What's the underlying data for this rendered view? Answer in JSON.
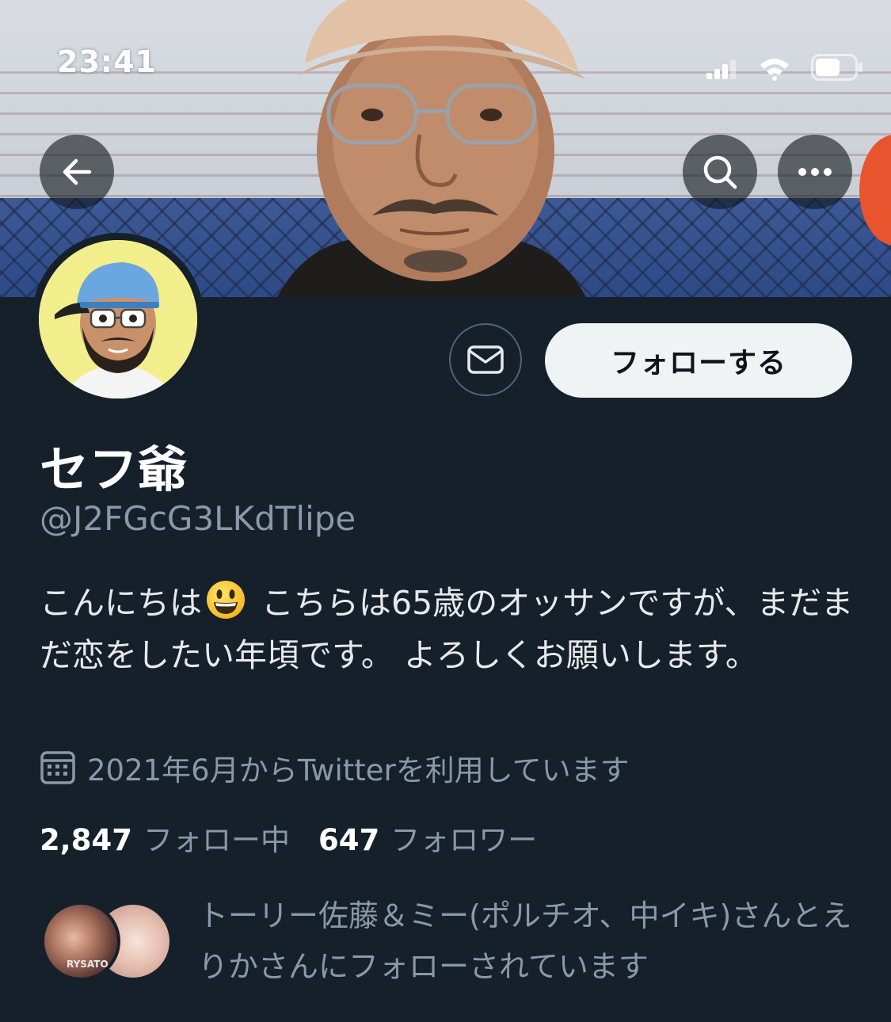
{
  "status_bar": {
    "time": "23:41",
    "signal_icon": "cellular-signal-icon",
    "wifi_icon": "wifi-icon",
    "battery_icon": "battery-icon"
  },
  "header": {
    "back_icon": "arrow-left-icon",
    "search_icon": "search-icon",
    "more_icon": "more-horizontal-icon"
  },
  "profile": {
    "display_name": "セフ爺",
    "handle": "@J2FGcG3LKdTlipe",
    "bio_part1": "こんにちは",
    "bio_emoji": "smiling-face-icon",
    "bio_part2": " こちらは65歳のオッサンですが、まだまだ恋をしたい年頃です。 よろしくお願いします。",
    "joined_icon": "calendar-icon",
    "joined": "2021年6月からTwitterを利用しています",
    "following_count": "2,847",
    "following_label": "フォロー中",
    "followers_count": "647",
    "followers_label": "フォロワー"
  },
  "actions": {
    "message_icon": "mail-icon",
    "follow_label": "フォローする"
  },
  "followed_by": {
    "avatar1_text": "RYSATO",
    "text": "トーリー佐藤＆ミー(ポルチオ、中イキ)さんとえりかさんにフォローされています"
  },
  "colors": {
    "background": "#15202b",
    "secondary_text": "#8b98a5",
    "follow_button_bg": "#eff3f4",
    "border": "#536471"
  }
}
